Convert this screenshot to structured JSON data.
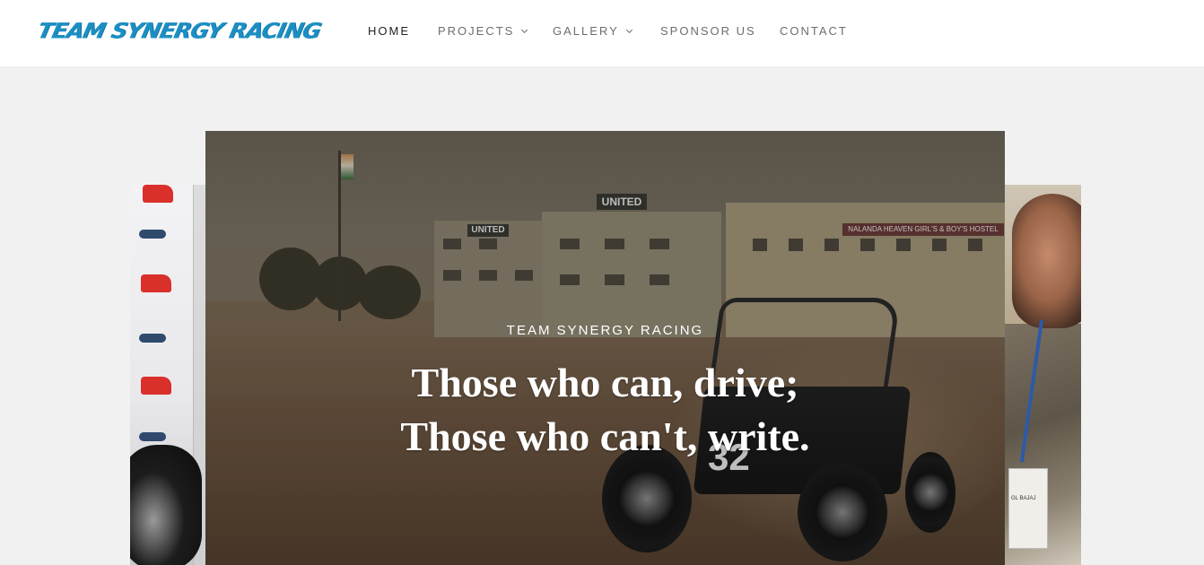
{
  "header": {
    "logo_text": "TEAM SYNERGY RACING",
    "brand_color": "#1b8fc4",
    "nav": [
      {
        "label": "HOME",
        "active": true,
        "dropdown": false
      },
      {
        "label": "PROJECTS",
        "active": false,
        "dropdown": true
      },
      {
        "label": "GALLERY",
        "active": false,
        "dropdown": true
      },
      {
        "label": "SPONSOR US",
        "active": false,
        "dropdown": false
      },
      {
        "label": "CONTACT",
        "active": false,
        "dropdown": false
      }
    ]
  },
  "hero": {
    "kicker": "TEAM SYNERGY RACING",
    "headline_line1": "Those who can, drive;",
    "headline_line2": "Those who can't, write.",
    "photo_signs": {
      "united_1": "UNITED",
      "united_2": "UNITED",
      "hostel": "NALANDA HEAVEN GIRL'S & BOY'S HOSTEL",
      "car_number": "32"
    }
  },
  "right_slide": {
    "badge_text": "GL BAJAJ"
  }
}
